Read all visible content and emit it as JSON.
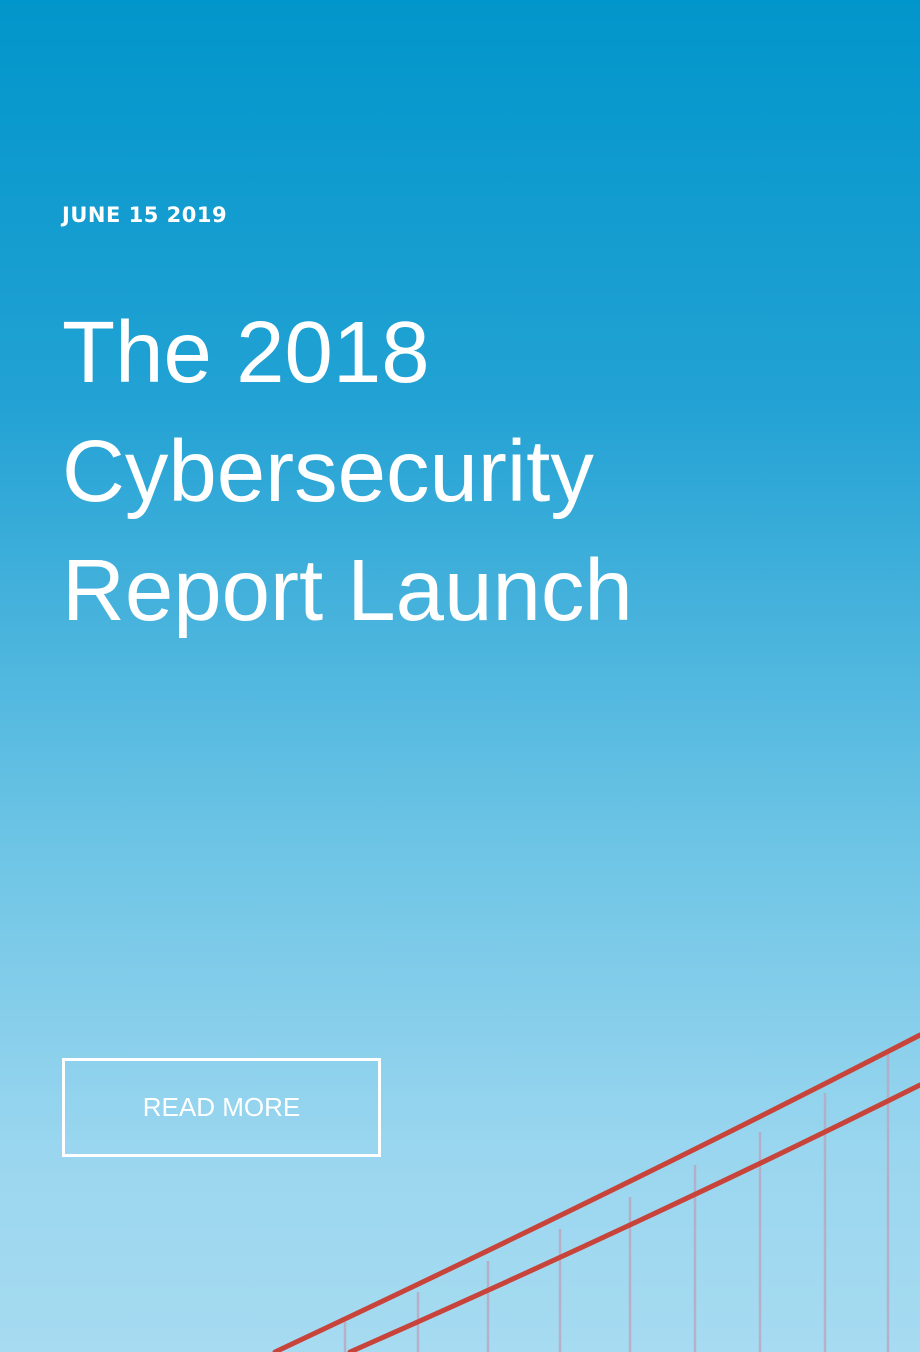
{
  "card": {
    "date": "JUNE 15 2019",
    "title_lines": [
      "The 2018",
      "Cybersecurity",
      "Report Launch"
    ],
    "cta_label": "READ MORE"
  },
  "colors": {
    "sky_top": "#0196cb",
    "sky_bottom": "#a6dbf1",
    "bridge_cable": "#c8443a",
    "text": "#ffffff"
  },
  "background_image": "golden-gate-bridge-cables-against-blue-sky"
}
